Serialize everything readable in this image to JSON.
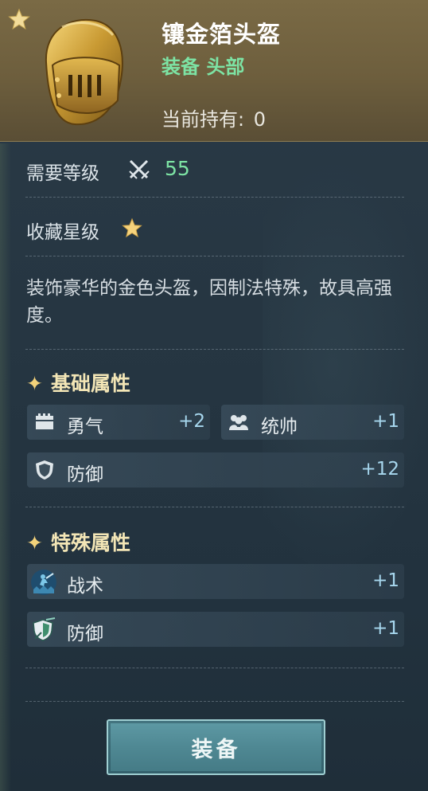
{
  "item": {
    "name": "镶金箔头盔",
    "type": "装备 头部",
    "owned_label": "当前持有:",
    "owned_value": "0"
  },
  "level": {
    "label": "需要等级",
    "value": "55"
  },
  "collect": {
    "label": "收藏星级",
    "stars": 1
  },
  "description": "装饰豪华的金色头盔，因制法特殊，故具高强度。",
  "basic": {
    "title": "基础属性",
    "attrs": [
      {
        "icon": "courage-icon",
        "name": "勇气",
        "value": "+2"
      },
      {
        "icon": "command-icon",
        "name": "统帅",
        "value": "+1"
      },
      {
        "icon": "shield-icon",
        "name": "防御",
        "value": "+12"
      }
    ]
  },
  "special": {
    "title": "特殊属性",
    "attrs": [
      {
        "icon": "tactics-icon",
        "name": "战术",
        "value": "+1"
      },
      {
        "icon": "defense-skill-icon",
        "name": "防御",
        "value": "+1"
      }
    ]
  },
  "button": {
    "label": "装备"
  },
  "colors": {
    "header": "#6d5e3d",
    "type_green": "#7de3a4",
    "level_green": "#7de3a4",
    "value_blue": "#a7d7ee",
    "button": "#4f8893"
  }
}
